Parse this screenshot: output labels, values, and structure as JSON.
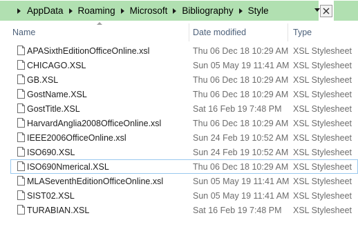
{
  "address": {
    "path": [
      "AppData",
      "Roaming",
      "Microsoft",
      "Bibliography",
      "Style"
    ]
  },
  "columns": {
    "name": "Name",
    "date": "Date modified",
    "type": "Type"
  },
  "files": [
    {
      "name": "APASixthEditionOfficeOnline.xsl",
      "date": "Thu 06 Dec 18 10:29 AM",
      "type": "XSL Stylesheet"
    },
    {
      "name": "CHICAGO.XSL",
      "date": "Sun 05 May 19 11:41 AM",
      "type": "XSL Stylesheet"
    },
    {
      "name": "GB.XSL",
      "date": "Thu 06 Dec 18 10:29 AM",
      "type": "XSL Stylesheet"
    },
    {
      "name": "GostName.XSL",
      "date": "Thu 06 Dec 18 10:29 AM",
      "type": "XSL Stylesheet"
    },
    {
      "name": "GostTitle.XSL",
      "date": "Sat 16 Feb 19 7:48 PM",
      "type": "XSL Stylesheet"
    },
    {
      "name": "HarvardAnglia2008OfficeOnline.xsl",
      "date": "Thu 06 Dec 18 10:29 AM",
      "type": "XSL Stylesheet"
    },
    {
      "name": "IEEE2006OfficeOnline.xsl",
      "date": "Sun 24 Feb 19 10:52 AM",
      "type": "XSL Stylesheet"
    },
    {
      "name": "ISO690.XSL",
      "date": "Sun 24 Feb 19 10:52 AM",
      "type": "XSL Stylesheet"
    },
    {
      "name": "ISO690Nmerical.XSL",
      "date": "Thu 06 Dec 18 10:29 AM",
      "type": "XSL Stylesheet"
    },
    {
      "name": "MLASeventhEditionOfficeOnline.xsl",
      "date": "Sun 05 May 19 11:41 AM",
      "type": "XSL Stylesheet"
    },
    {
      "name": "SIST02.XSL",
      "date": "Sun 05 May 19 11:41 AM",
      "type": "XSL Stylesheet"
    },
    {
      "name": "TURABIAN.XSL",
      "date": "Sat 16 Feb 19 7:48 PM",
      "type": "XSL Stylesheet"
    }
  ],
  "focused_row": 8,
  "icons": {
    "separator": "chevron-right-icon",
    "dropdown": "chevron-down-icon",
    "close": "close-icon",
    "file": "file-icon"
  },
  "colors": {
    "address_bar_bg": "#b1e0b1",
    "header_text": "#4c607a",
    "focus_outline": "#99c9ef"
  }
}
